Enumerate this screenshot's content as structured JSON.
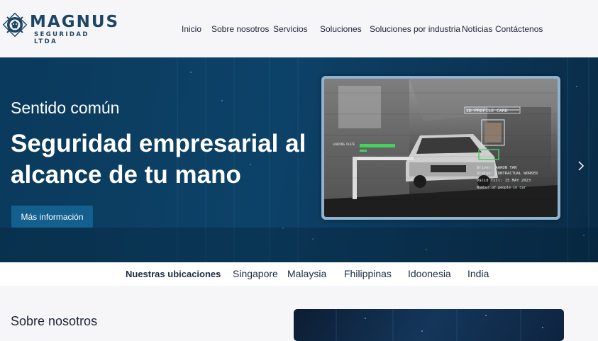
{
  "brand": {
    "name": "MAGNUS",
    "tagline": "SEGURIDAD LTDA",
    "logo_icon": "lion-emblem-icon",
    "color": "#1d4566"
  },
  "nav": {
    "items": [
      {
        "label": "Inicio"
      },
      {
        "label": "Sobre nosotros"
      },
      {
        "label": "Servicios"
      },
      {
        "label": "Soluciones"
      },
      {
        "label": "Soluciones por industria"
      },
      {
        "label": "Notícias"
      },
      {
        "label": "Contáctenos"
      }
    ]
  },
  "hero": {
    "eyebrow": "Sentido común",
    "title": "Seguridad empresarial al alcance de tu mano",
    "button_label": "Más información",
    "button_color": "#13608f",
    "next_icon": "chevron-right-icon",
    "image": {
      "profile_label": "ID PROFILE CARD",
      "loading_label": "LOADING PLATE",
      "driver": "Driver: AARON TAN",
      "status": "Status: CONTRACTUAL WORKER",
      "valid": "Valid Till: 15 MAY 2023",
      "people": "Number of people in car"
    }
  },
  "locations": {
    "label": "Nuestras ubicaciones",
    "separator": ":",
    "items": [
      "Singapore",
      "Malaysia",
      "Fhilippinas",
      "Idoonesia",
      "India"
    ]
  },
  "about": {
    "title": "Sobre nosotros"
  }
}
